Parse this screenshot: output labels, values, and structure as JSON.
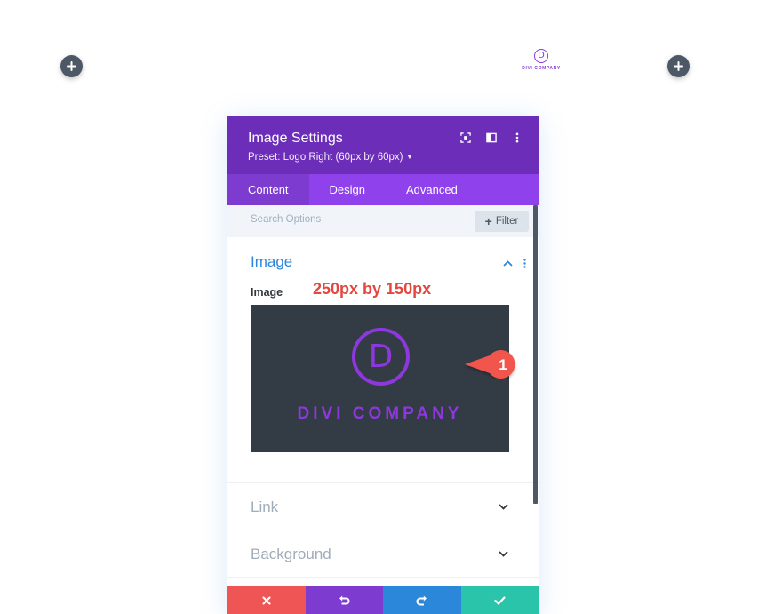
{
  "canvas": {
    "logo_letter": "D",
    "logo_text": "DIVI COMPANY",
    "add_left_icon": "plus-icon",
    "add_right_icon": "plus-icon"
  },
  "modal": {
    "title": "Image Settings",
    "preset": "Preset: Logo Right (60px by 60px)",
    "header_icons": [
      "fullscreen-icon",
      "split-view-icon",
      "more-vertical-icon"
    ],
    "tabs": [
      {
        "label": "Content",
        "active": true
      },
      {
        "label": "Design",
        "active": false
      },
      {
        "label": "Advanced",
        "active": false
      }
    ],
    "search": {
      "placeholder": "Search Options",
      "filter_label": "Filter"
    },
    "image_section": {
      "title": "Image",
      "field_label": "Image",
      "annotation": "250px by 150px",
      "preview_logo_letter": "D",
      "preview_logo_text": "DIVI COMPANY",
      "callout_number": "1"
    },
    "accordions": [
      {
        "label": "Link"
      },
      {
        "label": "Background"
      }
    ],
    "footer_icons": [
      "close-icon",
      "undo-icon",
      "redo-icon",
      "check-icon"
    ]
  },
  "colors": {
    "header": "#6c2eb9",
    "tabs": "#8f42ec",
    "accent_blue": "#2b87da",
    "brand_purple": "#8c38dc",
    "annotation_red": "#e2483f",
    "discard": "#ef5555",
    "save": "#29c4a9"
  }
}
